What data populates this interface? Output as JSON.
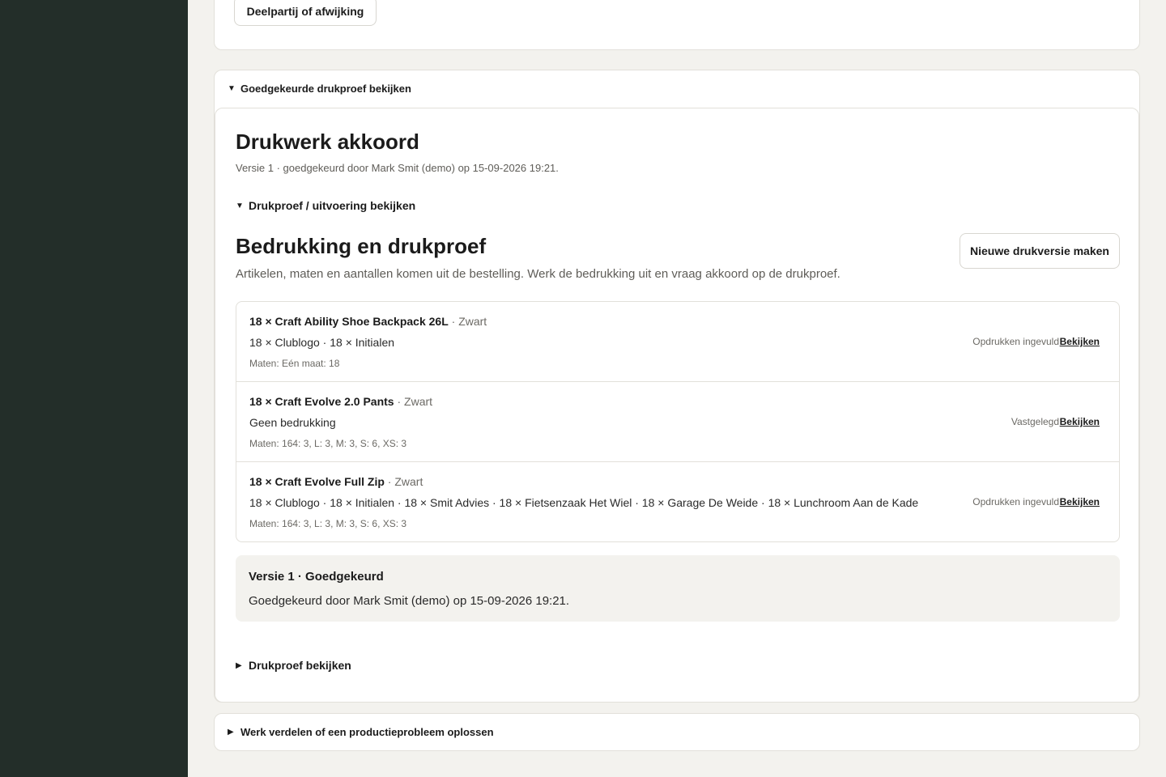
{
  "top_card": {
    "button_label": "Deelpartij of afwijking"
  },
  "approved_card": {
    "summary": "Goedgekeurde drukproef bekijken",
    "title": "Drukwerk akkoord",
    "meta": "Versie 1 · goedgekeurd door Mark Smit (demo) op 15-09-2026 19:21.",
    "drukproef_summary": "Drukproef / uitvoering bekijken",
    "section_title": "Bedrukking en drukproef",
    "section_subtitle": "Artikelen, maten en aantallen komen uit de bestelling. Werk de bedrukking uit en vraag akkoord op de drukproef.",
    "new_version_button": "Nieuwe drukversie maken",
    "items": [
      {
        "name": "18 × Craft Ability Shoe Backpack 26L",
        "color": " · Zwart",
        "print": "18 × Clublogo · 18 × Initialen",
        "sizes": "Maten: Eén maat: 18",
        "status": "Opdrukken ingevuld",
        "link": "Bekijken"
      },
      {
        "name": "18 × Craft Evolve 2.0 Pants",
        "color": " · Zwart",
        "print": "Geen bedrukking",
        "sizes": "Maten: 164: 3, L: 3, M: 3, S: 6, XS: 3",
        "status": "Vastgelegd",
        "link": "Bekijken"
      },
      {
        "name": "18 × Craft Evolve Full Zip",
        "color": " · Zwart",
        "print": "18 × Clublogo · 18 × Initialen · 18 × Smit Advies · 18 × Fietsenzaak Het Wiel · 18 × Garage De Weide · 18 × Lunchroom Aan de Kade",
        "sizes": "Maten: 164: 3, L: 3, M: 3, S: 6, XS: 3",
        "status": "Opdrukken ingevuld",
        "link": "Bekijken"
      }
    ],
    "version_box": {
      "title": "Versie 1 · Goedgekeurd",
      "text": "Goedgekeurd door Mark Smit (demo) op 15-09-2026 19:21."
    },
    "drukproef_bekijken": "Drukproef bekijken"
  },
  "werk_card": {
    "summary": "Werk verdelen of een productieprobleem oplossen"
  },
  "icons": {
    "expanded": "triangle-down-icon",
    "collapsed": "triangle-right-icon"
  },
  "colors": {
    "sidebar": "#232e29",
    "background": "#f3f2ee"
  }
}
